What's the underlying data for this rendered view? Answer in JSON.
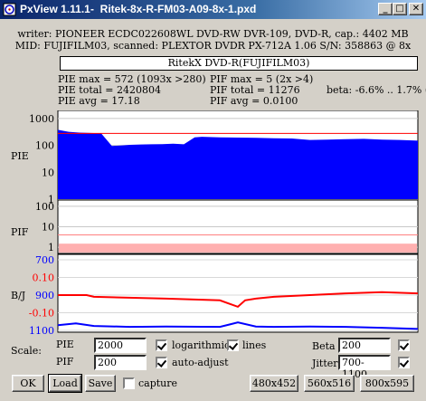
{
  "window": {
    "app_title": "PxView 1.11.1",
    "separator": "-",
    "file_title": "Ritek-8x-R-FM03-A09-8x-1.pxd",
    "min_glyph": "_",
    "max_glyph": "□",
    "close_glyph": "✕"
  },
  "info": {
    "line1": "writer: PIONEER ECDC022608WL DVD-RW DVR-109, DVD-R, cap.: 4402 MB",
    "line2": "MID: FUJIFILM03, scanned: PLEXTOR DVDR PX-712A 1.06 S/N: 358863 @ 8x"
  },
  "chart_title": "RitekX DVD-R(FUJIFILM03)",
  "stats": {
    "pie_max": "PIE max = 572 (1093x >280)",
    "pie_total": "PIE total = 2420804",
    "pie_avg": "PIE avg = 17.18",
    "pif_max": "PIF max = 5 (2x >4)",
    "pif_total": "PIF total = 11276",
    "pif_avg": "PIF avg = 0.0100",
    "beta": "beta: -6.6% .. 1.7% (!)"
  },
  "chart_data": {
    "type": "area",
    "panels": [
      {
        "name": "PIE",
        "scale": "log",
        "ticks": [
          "1000",
          "100",
          "10",
          "1"
        ],
        "ylim": [
          1,
          2000
        ],
        "threshold_line": 280,
        "x": [
          0,
          0.03,
          0.06,
          0.09,
          0.12,
          0.15,
          0.18,
          0.2,
          0.23,
          0.26,
          0.29,
          0.32,
          0.35,
          0.38,
          0.4,
          0.45,
          0.5,
          0.55,
          0.6,
          0.65,
          0.7,
          0.75,
          0.8,
          0.85,
          0.9,
          0.95,
          1.0
        ],
        "values": [
          380,
          320,
          300,
          290,
          280,
          95,
          100,
          105,
          108,
          110,
          112,
          115,
          110,
          200,
          210,
          200,
          195,
          190,
          185,
          180,
          160,
          165,
          170,
          175,
          165,
          160,
          150
        ],
        "color": "#0000ff"
      },
      {
        "name": "PIF",
        "scale": "log",
        "ticks": [
          "100",
          "10",
          "1"
        ],
        "ylim": [
          0.5,
          200
        ],
        "threshold_line": 4,
        "values_level": 1.5,
        "color": "#ffb0b0"
      },
      {
        "name": "B/J",
        "ticks_left": [
          "700",
          "0.10",
          "900",
          "-0.10",
          "1100"
        ],
        "series": [
          {
            "name": "Beta",
            "color": "#ff0000",
            "x": [
              0,
              0.08,
              0.1,
              0.3,
              0.45,
              0.5,
              0.52,
              0.55,
              0.6,
              0.7,
              0.8,
              0.9,
              1.0
            ],
            "values": [
              0.0,
              0.0,
              -0.01,
              -0.02,
              -0.03,
              -0.066,
              -0.03,
              -0.02,
              -0.01,
              0.0,
              0.01,
              0.017,
              0.01
            ]
          },
          {
            "name": "Jitter",
            "color": "#0000ff",
            "x": [
              0,
              0.05,
              0.1,
              0.2,
              0.3,
              0.45,
              0.5,
              0.55,
              0.6,
              0.7,
              0.8,
              0.9,
              1.0
            ],
            "values": [
              1070,
              1060,
              1075,
              1080,
              1078,
              1080,
              1055,
              1078,
              1080,
              1078,
              1080,
              1085,
              1092
            ]
          }
        ]
      }
    ]
  },
  "controls": {
    "scale_label": "Scale:",
    "pie_label": "PIE",
    "pie_value": "2000",
    "pif_label": "PIF",
    "pif_value": "200",
    "log_label": "logarithmic",
    "lines_label": "lines",
    "auto_label": "auto-adjust",
    "beta_label": "Beta",
    "beta_value": "200",
    "jitter_label": "Jitter",
    "jitter_value": "700-1100",
    "capture_label": "capture",
    "ok": "OK",
    "load": "Load",
    "save": "Save",
    "size1": "480x452",
    "size2": "560x516",
    "size3": "800x595"
  }
}
